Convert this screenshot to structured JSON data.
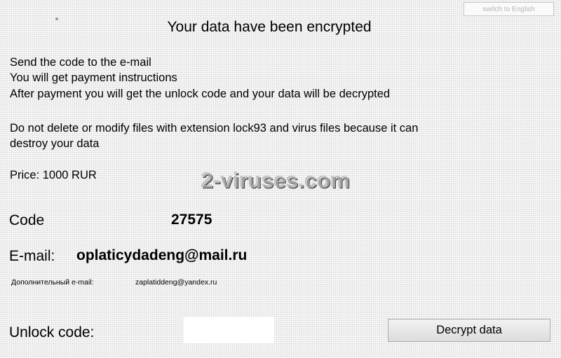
{
  "language_button": "switch to English",
  "title": "Your data have been encrypted",
  "message": {
    "line1": "Send the code to the e-mail",
    "line2": "You will get payment instructions",
    "line3": "After payment you will get the unlock code and your data will be decrypted",
    "warning_line1": "Do not delete or modify files with extension lock93 and virus files because it can",
    "warning_line2": "destroy your data",
    "price": "Price: 1000 RUR"
  },
  "watermark": "2-viruses.com",
  "code": {
    "label": "Code",
    "value": "27575"
  },
  "email": {
    "label": "E-mail:",
    "value": "oplaticydadeng@mail.ru"
  },
  "extra_email": {
    "label": "Дополнительный e-mail:",
    "value": "zaplatiddeng@yandex.ru"
  },
  "unlock": {
    "label": "Unlock code:",
    "input_value": ""
  },
  "decrypt_button": "Decrypt data"
}
